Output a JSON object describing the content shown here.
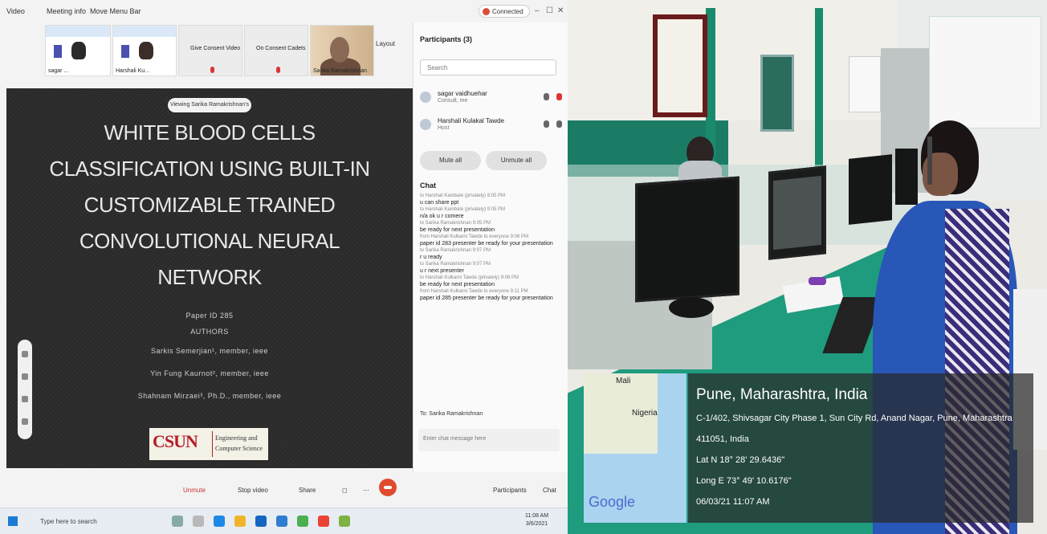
{
  "topbar": {
    "video_label": "Video",
    "meeting_info_label": "Meeting info",
    "more_label": "Move Menu Bar",
    "camera_label": "Connected",
    "win_min": "–",
    "win_max": "☐",
    "win_close": "✕"
  },
  "strip": {
    "thumbs": [
      {
        "name": "sagar ..."
      },
      {
        "name": "Harshali Ku..."
      },
      {
        "name": "Give Consent Video"
      },
      {
        "name": "On Consent Cadets"
      },
      {
        "name": "Sarika Ramakrishnan"
      }
    ],
    "layout_label": "Layout"
  },
  "slide": {
    "viewing": "Viewing Sarika Ramakrishnan's ...",
    "title_lines": [
      "WHITE BLOOD CELLS",
      "CLASSIFICATION USING BUILT-IN",
      "CUSTOMIZABLE TRAINED",
      "CONVOLUTIONAL NEURAL",
      "NETWORK"
    ],
    "paper_id": "Paper ID 285",
    "authors_label": "AUTHORS",
    "authors": [
      "Sarkis Semerjian¹, member, ieee",
      "Yin Fung Kaurnot², member, ieee",
      "Shahnam Mirzaei³, Ph.D., member, ieee"
    ],
    "logo_text": "CSUN",
    "logo_sub1": "Engineering and",
    "logo_sub2": "Computer Science"
  },
  "panel": {
    "participants_header": "Participants (3)",
    "search_placeholder": "Search",
    "participants": [
      {
        "name": "sagar vaidhuehar",
        "role": "Consult, me"
      },
      {
        "name": "Harshali Kulakal Tawde",
        "role": "Host"
      }
    ],
    "mute_all": "Mute all",
    "unmute_all": "Unmute all",
    "chat_header": "Chat",
    "chat": [
      {
        "meta": "to Harshali Kambale (privately) 9:05 PM",
        "msg": "u can share ppt"
      },
      {
        "meta": "to Harshali Kambale (privately) 9:05 PM",
        "msg": "n/a ok u r comere"
      },
      {
        "meta": "to Sarika Ramakrishnan 9:05 PM",
        "msg": "be ready for next presentation"
      },
      {
        "meta": "from Harshali Kulkarni Tawde to everyone 9:06 PM",
        "msg": "paper id 283 presenter be ready for your presentation"
      },
      {
        "meta": "to Sarika Ramakrishnan 9:07 PM",
        "msg": "r u ready"
      },
      {
        "meta": "to Sarika Ramakrishnan 9:07 PM",
        "msg": "u r next presenter"
      },
      {
        "meta": "to Harshali Kulkarni Tawde (privately) 9:08 PM",
        "msg": "be ready for next presentation"
      },
      {
        "meta": "from Harshali Kulkarni Tawde to everyone 9:11 PM",
        "msg": "paper id 285 presenter be ready for your presentation"
      }
    ],
    "to_label": "To:",
    "to_value": "Sarika Ramakrishnan",
    "input_placeholder": "Enter chat message here"
  },
  "toolbar": {
    "unmute": "Unmute",
    "stop_video": "Stop video",
    "share": "Share",
    "participants": "Participants",
    "chat": "Chat"
  },
  "taskbar": {
    "search": "Type here to search",
    "time": "11:08 AM",
    "date": "3/6/2021"
  },
  "geotag": {
    "city": "Pune, Maharashtra, India",
    "address1": "C-1/402, Shivsagar City Phase 1, Sun City Rd, Anand Nagar, Pune, Maharashtra",
    "address2": "411051, India",
    "lat": "Lat N 18° 28' 29.6436\"",
    "long": "Long E 73° 49' 10.6176\"",
    "datetime": "06/03/21 11:07 AM",
    "map_label_1": "Mali",
    "map_label_2": "Nigeria",
    "map_brand": "Google"
  }
}
